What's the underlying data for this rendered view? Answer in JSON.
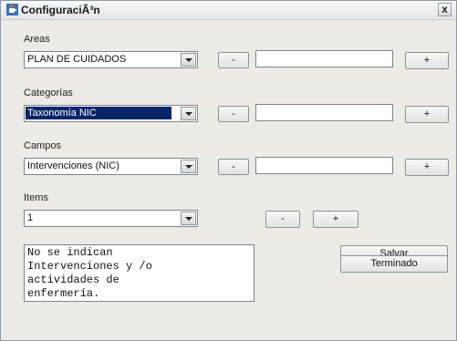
{
  "window": {
    "title": "ConfiguraciÃ³n",
    "close_glyph": "x"
  },
  "areas": {
    "label": "Areas",
    "selected": "PLAN DE CUIDADOS",
    "remove_label": "-",
    "add_label": "+",
    "new_value": ""
  },
  "categorias": {
    "label": "Categorías",
    "selected": "Taxonomía NIC",
    "remove_label": "-",
    "add_label": "+",
    "new_value": ""
  },
  "campos": {
    "label": "Campos",
    "selected": "Intervenciones (NIC)",
    "remove_label": "-",
    "add_label": "+",
    "new_value": ""
  },
  "items": {
    "label": "Items",
    "selected": "1",
    "remove_label": "-",
    "add_label": "+"
  },
  "message": {
    "text": "No se indican\nIntervenciones y /o\nactividades de\nenfermería."
  },
  "actions": {
    "save_label": "Salvar",
    "done_label": "Terminado"
  },
  "icons": {
    "app": "java-cup-icon",
    "close": "close-icon",
    "dropdown": "chevron-down-icon"
  }
}
